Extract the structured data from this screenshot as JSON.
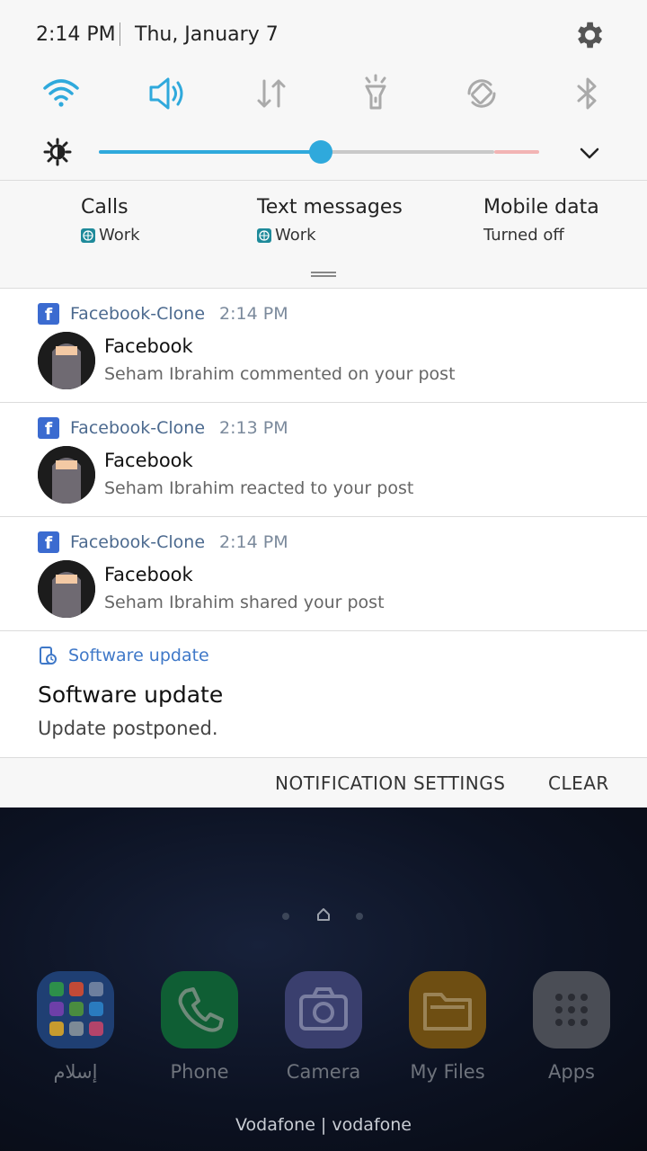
{
  "status": {
    "time": "2:14 PM",
    "date": "Thu, January 7"
  },
  "quick_settings": {
    "icons": [
      "wifi-icon",
      "sound-icon",
      "mobile-data-icon",
      "flashlight-icon",
      "auto-rotate-icon",
      "bluetooth-icon"
    ],
    "brightness_level": 0.5
  },
  "sim_cards": [
    {
      "title": "Calls",
      "value": "Work"
    },
    {
      "title": "Text messages",
      "value": "Work"
    },
    {
      "title": "Mobile data",
      "value": "Turned off"
    }
  ],
  "notifications": [
    {
      "app": "Facebook-Clone",
      "time": "2:14 PM",
      "title": "Facebook",
      "body": "Seham Ibrahim commented on your post"
    },
    {
      "app": "Facebook-Clone",
      "time": "2:13 PM",
      "title": "Facebook",
      "body": "Seham Ibrahim reacted to your post"
    },
    {
      "app": "Facebook-Clone",
      "time": "2:14 PM",
      "title": "Facebook",
      "body": "Seham Ibrahim shared your post"
    }
  ],
  "software_update": {
    "app": "Software update",
    "title": "Software update",
    "body": "Update postponed."
  },
  "actions": {
    "settings": "NOTIFICATION SETTINGS",
    "clear": "CLEAR"
  },
  "dock": [
    {
      "label": "إسلام",
      "icon": "folder-icon"
    },
    {
      "label": "Phone",
      "icon": "phone-icon"
    },
    {
      "label": "Camera",
      "icon": "camera-icon"
    },
    {
      "label": "My Files",
      "icon": "files-icon"
    },
    {
      "label": "Apps",
      "icon": "apps-grid-icon"
    }
  ],
  "carrier": "Vodafone | vodafone",
  "colors": {
    "accent": "#2fa9dc",
    "facebook": "#3b6bd0",
    "link": "#3f78c8"
  }
}
